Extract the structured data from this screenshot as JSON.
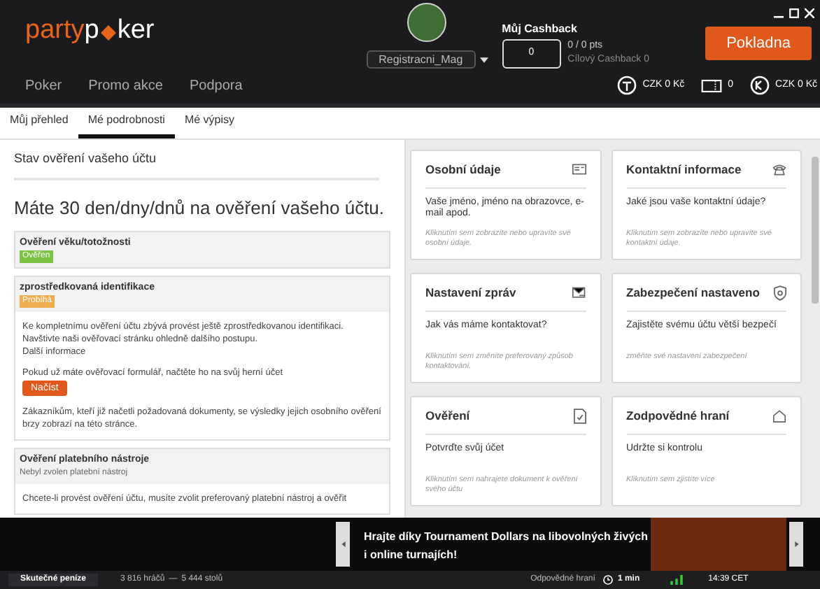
{
  "header": {
    "logo_left": "party",
    "logo_mid": "p",
    "logo_right": "ker",
    "username": "Registracni_Mag",
    "cashback_title": "Můj Cashback",
    "cashback_value": "0",
    "cashback_pts": "0 / 0 pts",
    "cashback_target": "Cílový Cashback 0",
    "cashier_button": "Pokladna"
  },
  "nav": [
    {
      "label": "Poker"
    },
    {
      "label": "Promo akce"
    },
    {
      "label": "Podpora"
    }
  ],
  "balances": [
    {
      "kind": "tdollar",
      "text": "CZK 0 Kč"
    },
    {
      "kind": "ticket",
      "text": "0"
    },
    {
      "kind": "coin",
      "text": "CZK 0 Kč"
    }
  ],
  "tabs": [
    {
      "label": "Můj přehled",
      "selected": false
    },
    {
      "label": "Mé podrobnosti",
      "selected": true
    },
    {
      "label": "Mé výpisy",
      "selected": false
    }
  ],
  "verification": {
    "title": "Stav ověření vašeho účtu",
    "days_notice": "Máte 30 den/dny/dnů na ověření vašeho účtu.",
    "sections": [
      {
        "title": "Ověření věku/totožnosti",
        "status": "Ověřen",
        "color": "#7cc242"
      },
      {
        "title": "zprostředkovaná identifikace",
        "status": "Probíhá",
        "color": "#f0ad4e",
        "lines": [
          {
            "kind": "text",
            "text": "Ke kompletnímu ověření účtu zbývá provést ještě zprostředkovanou identifikaci."
          },
          {
            "kind": "text",
            "text": "Navštivte naši ověřovací stránku ohledně dalšího postupu."
          },
          {
            "kind": "text",
            "text": "Další informace"
          },
          {
            "kind": "gap"
          },
          {
            "kind": "text",
            "text": "Pokud už máte ověřovací formulář, načtěte ho na svůj herní účet"
          },
          {
            "kind": "button",
            "text": "Načíst"
          },
          {
            "kind": "gap"
          },
          {
            "kind": "text",
            "text": "Zákazníkům, kteří již načetli požadovaná dokumenty, se výsledky jejich osobního ověření brzy zobrazí na této stránce."
          }
        ]
      },
      {
        "title": "Ověření platebního nástroje",
        "subtitle": "Nebyl zvolen platební nástroj",
        "lines": [
          {
            "kind": "text",
            "text": "Chcete-li provést ověření účtu, musíte zvolit preferovaný platební nástroj a ověřit"
          }
        ]
      }
    ]
  },
  "cards": [
    {
      "kind": "id",
      "title": "Osobní údaje",
      "question": "Vaše jméno, jméno na obrazovce, e-mail apod.",
      "hint": "Kliknutím sem zobrazíte nebo upravíte své osobní údaje."
    },
    {
      "kind": "phone",
      "title": "Kontaktní informace",
      "question": "Jaké jsou vaše kontaktní údaje?",
      "hint": "Kliknutím sem zobrazíte nebo upravíte své kontaktní údaje."
    },
    {
      "kind": "message",
      "title": "Nastavení zpráv",
      "question": "Jak vás máme kontaktovat?",
      "hint": "Kliknutím sem změníte preferovaný způsob kontaktování."
    },
    {
      "kind": "shield",
      "title": "Zabezpečení nastaveno",
      "question": "Zajistěte svému účtu větší bezpečí",
      "hint": "změňte své nastavení zabezpečení"
    },
    {
      "kind": "document",
      "title": "Ověření",
      "question": "Potvrďte svůj účet",
      "hint": "Kliknutím sem nahrajete dokument k ověření svého účtu"
    },
    {
      "kind": "home",
      "title": "Zodpovědné hraní",
      "question": "Udržte si kontrolu",
      "hint": "Kliknutím sem zjistíte více"
    }
  ],
  "banner": {
    "text": "Hrajte díky Tournament Dollars na libovolných živých i online turnajích!"
  },
  "status_bar": {
    "mode": "Skutečné peníze",
    "players": "3 816 hráčů",
    "separator": "—",
    "tables": "5 444 stolů",
    "responsible": "Odpovědné hraní",
    "timer": "1 min",
    "time": "14:39 CET"
  }
}
